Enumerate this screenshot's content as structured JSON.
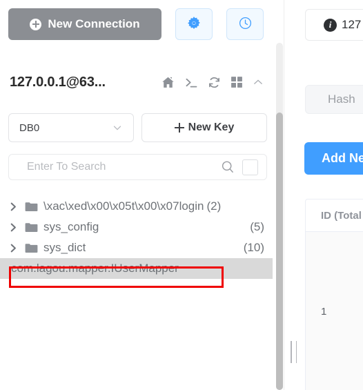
{
  "toolbar": {
    "new_connection_label": "New Connection",
    "new_connection_icon": "plus-circle-icon",
    "settings_icon": "gear-icon",
    "history_icon": "clock-icon"
  },
  "connection": {
    "title": "127.0.0.1@63...",
    "actions": [
      {
        "name": "home-icon",
        "label": "Home"
      },
      {
        "name": "terminal-icon",
        "label": "Console"
      },
      {
        "name": "refresh-icon",
        "label": "Refresh"
      },
      {
        "name": "grid-icon",
        "label": "Apps"
      },
      {
        "name": "chevron-up-icon",
        "label": "Collapse"
      }
    ]
  },
  "db": {
    "selected": "DB0",
    "new_key_label": "New Key",
    "chevron_icon": "chevron-down-icon"
  },
  "search": {
    "value": "",
    "placeholder": "Enter To Search",
    "search_icon": "search-icon",
    "checkbox_checked": false
  },
  "key_tree": [
    {
      "type": "folder",
      "label": "\\xac\\xed\\x00\\x05t\\x00\\x07login",
      "count": "(2)",
      "count_inline": true,
      "expanded": false,
      "selected": false
    },
    {
      "type": "folder",
      "label": "sys_config",
      "count": "(5)",
      "count_inline": false,
      "expanded": false,
      "selected": false
    },
    {
      "type": "folder",
      "label": "sys_dict",
      "count": "(10)",
      "count_inline": false,
      "expanded": false,
      "selected": false
    },
    {
      "type": "key",
      "label": "com.lagou.mapper.IUserMapper",
      "count": "",
      "count_inline": false,
      "expanded": false,
      "selected": true
    }
  ],
  "annotation": {
    "color": "#ef0000",
    "target": "com.lagou.mapper.IUserMapper"
  },
  "right_panel": {
    "info_icon": "info-icon",
    "info_text": "127",
    "type_tab_label": "Hash",
    "add_new_label": "Add Ne",
    "table": {
      "columns": [
        "ID (Total"
      ],
      "rows": [
        [
          "1"
        ]
      ]
    }
  },
  "colors": {
    "primary_button": "#409eff",
    "new_connection_button": "#8b8e93",
    "accent_icon": "#409eff",
    "selected_row": "#d9d9d9",
    "annotation": "#ef0000"
  },
  "splitter": {
    "handle_icon": "drag-handle-icon"
  },
  "scrollbar": {
    "name": "left-panel-scrollbar"
  }
}
